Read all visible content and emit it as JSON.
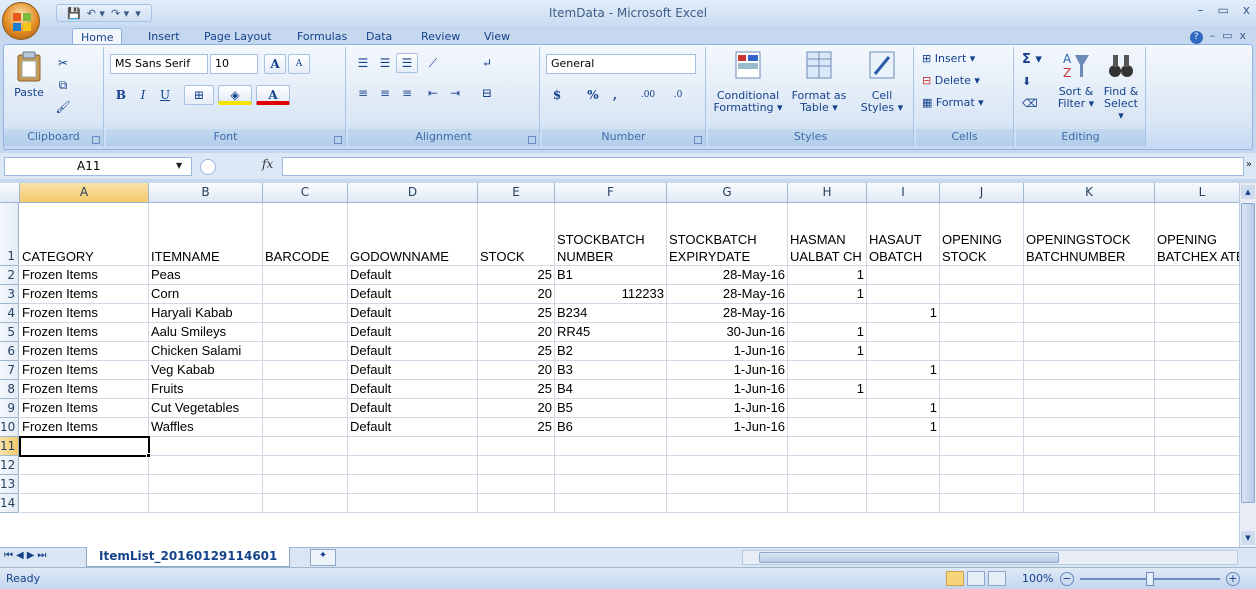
{
  "window": {
    "title": "ItemData - Microsoft Excel",
    "minimize": "–",
    "restore": "▭",
    "close": "x"
  },
  "qat": {
    "save": "💾",
    "undo": "↶ ▾",
    "redo": "↷ ▾",
    "customize": "▾"
  },
  "tabs": [
    "Home",
    "Insert",
    "Page Layout",
    "Formulas",
    "Data",
    "Review",
    "View"
  ],
  "active_tab": "Home",
  "ribbon": {
    "clipboard": {
      "label": "Clipboard",
      "paste": "Paste"
    },
    "font": {
      "label": "Font",
      "name": "MS Sans Serif",
      "size": "10",
      "bold": "B",
      "italic": "I",
      "underline": "U",
      "grow": "A",
      "shrink": "A"
    },
    "alignment": {
      "label": "Alignment"
    },
    "number": {
      "label": "Number",
      "format": "General",
      "currency": "$",
      "percent": "%",
      "comma": ",",
      "inc_dec": ".00",
      "dec_dec": ".0"
    },
    "styles": {
      "label": "Styles",
      "conditional": "Conditional Formatting ▾",
      "format_table": "Format as Table ▾",
      "cell_styles": "Cell Styles ▾"
    },
    "cells": {
      "label": "Cells",
      "insert": "Insert ▾",
      "delete": "Delete ▾",
      "format": "Format ▾"
    },
    "editing": {
      "label": "Editing",
      "sigma": "Σ ▾",
      "sort": "Sort & Filter ▾",
      "find": "Find & Select ▾"
    }
  },
  "formula_bar": {
    "name_box": "A11",
    "fx": "fx",
    "value": ""
  },
  "columns": [
    "A",
    "B",
    "C",
    "D",
    "E",
    "F",
    "G",
    "H",
    "I",
    "J",
    "K",
    "L"
  ],
  "row_numbers": [
    "1",
    "2",
    "3",
    "4",
    "5",
    "6",
    "7",
    "8",
    "9",
    "10",
    "11",
    "12",
    "13",
    "14"
  ],
  "header_row": [
    "CATEGORY",
    "ITEMNAME",
    "BARCODE",
    "GODOWNNAME",
    "STOCK",
    "STOCKBATCH NUMBER",
    "STOCKBATCH EXPIRYDATE",
    "HASMAN UALBAT CH",
    "HASAUT OBATCH",
    "OPENING STOCK",
    "OPENINGSTOCK BATCHNUMBER",
    "OPENING BATCHEX ATE"
  ],
  "rows": [
    [
      "Frozen Items",
      "Peas",
      "",
      "Default",
      "25",
      "B1",
      "28-May-16",
      "1",
      "",
      "",
      "",
      ""
    ],
    [
      "Frozen Items",
      "Corn",
      "",
      "Default",
      "20",
      "112233",
      "28-May-16",
      "1",
      "",
      "",
      "",
      ""
    ],
    [
      "Frozen Items",
      "Haryali Kabab",
      "",
      "Default",
      "25",
      "B234",
      "28-May-16",
      "",
      "1",
      "",
      "",
      ""
    ],
    [
      "Frozen Items",
      "Aalu Smileys",
      "",
      "Default",
      "20",
      "RR45",
      "30-Jun-16",
      "1",
      "",
      "",
      "",
      ""
    ],
    [
      "Frozen Items",
      "Chicken Salami",
      "",
      "Default",
      "25",
      "B2",
      "1-Jun-16",
      "1",
      "",
      "",
      "",
      ""
    ],
    [
      "Frozen Items",
      "Veg Kabab",
      "",
      "Default",
      "20",
      "B3",
      "1-Jun-16",
      "",
      "1",
      "",
      "",
      ""
    ],
    [
      "Frozen Items",
      "Fruits",
      "",
      "Default",
      "25",
      "B4",
      "1-Jun-16",
      "1",
      "",
      "",
      "",
      ""
    ],
    [
      "Frozen Items",
      "Cut Vegetables",
      "",
      "Default",
      "20",
      "B5",
      "1-Jun-16",
      "",
      "1",
      "",
      "",
      ""
    ],
    [
      "Frozen Items",
      "Waffles",
      "",
      "Default",
      "25",
      "B6",
      "1-Jun-16",
      "",
      "1",
      "",
      "",
      ""
    ]
  ],
  "sheet_tab": "ItemList_20160129114601",
  "status": {
    "ready": "Ready",
    "zoom": "100%"
  }
}
